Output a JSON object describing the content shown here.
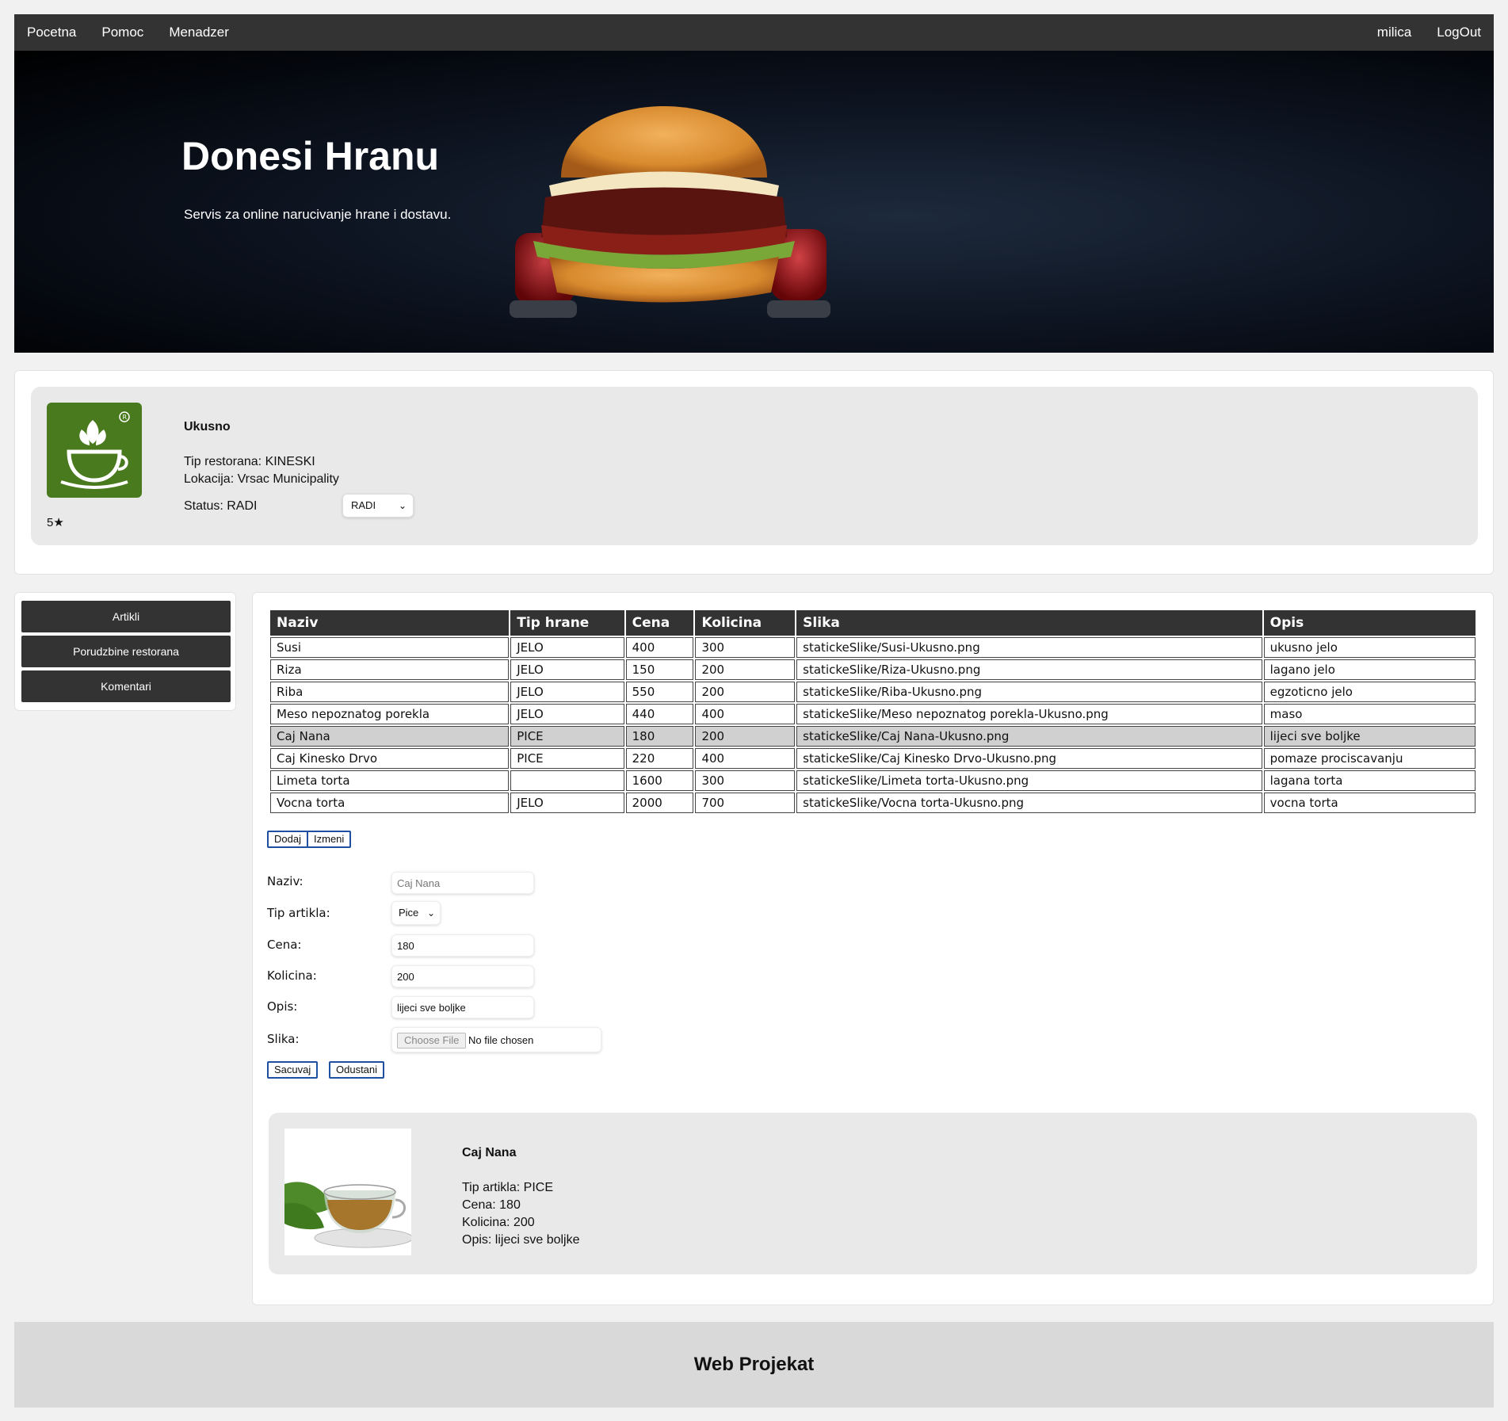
{
  "nav": {
    "left": [
      "Pocetna",
      "Pomoc",
      "Menadzer"
    ],
    "user": "milica",
    "logout": "LogOut"
  },
  "hero": {
    "title": "Donesi Hranu",
    "subtitle": "Servis za online narucivanje hrane i dostavu."
  },
  "restaurant": {
    "name": "Ukusno",
    "type": "Tip restorana: KINESKI",
    "location": "Lokacija: Vrsac Municipality",
    "status": "Status: RADI",
    "status_select": "RADI",
    "rating": "5★",
    "logo_color": "#4a7a1e",
    "logo_icon": "tea-cup-logo-icon"
  },
  "sidebar": {
    "items": [
      "Artikli",
      "Porudzbine restorana",
      "Komentari"
    ]
  },
  "table": {
    "headers": [
      "Naziv",
      "Tip hrane",
      "Cena",
      "Kolicina",
      "Slika",
      "Opis"
    ],
    "rows": [
      [
        "Susi",
        "JELO",
        "400",
        "300",
        "statickeSlike/Susi-Ukusno.png",
        "ukusno jelo"
      ],
      [
        "Riza",
        "JELO",
        "150",
        "200",
        "statickeSlike/Riza-Ukusno.png",
        "lagano jelo"
      ],
      [
        "Riba",
        "JELO",
        "550",
        "200",
        "statickeSlike/Riba-Ukusno.png",
        "egzoticno jelo"
      ],
      [
        "Meso nepoznatog porekla",
        "JELO",
        "440",
        "400",
        "statickeSlike/Meso nepoznatog porekla-Ukusno.png",
        "maso"
      ],
      [
        "Caj Nana",
        "PICE",
        "180",
        "200",
        "statickeSlike/Caj Nana-Ukusno.png",
        "lijeci sve boljke"
      ],
      [
        "Caj Kinesko Drvo",
        "PICE",
        "220",
        "400",
        "statickeSlike/Caj Kinesko Drvo-Ukusno.png",
        "pomaze prociscavanju"
      ],
      [
        "Limeta torta",
        "",
        "1600",
        "300",
        "statickeSlike/Limeta torta-Ukusno.png",
        "lagana torta"
      ],
      [
        "Vocna torta",
        "JELO",
        "2000",
        "700",
        "statickeSlike/Vocna torta-Ukusno.png",
        "vocna torta"
      ]
    ],
    "selected_row": 4
  },
  "actions": {
    "add": "Dodaj",
    "edit": "Izmeni"
  },
  "form": {
    "naziv_label": "Naziv:",
    "naziv_placeholder": "Caj Nana",
    "tip_label": "Tip artikla:",
    "tip_value": "Pice",
    "cena_label": "Cena:",
    "cena_value": "180",
    "kolicina_label": "Kolicina:",
    "kolicina_value": "200",
    "opis_label": "Opis:",
    "opis_value": "lijeci sve boljke",
    "slika_label": "Slika:",
    "file_button": "Choose File",
    "file_status": "No file chosen",
    "save": "Sacuvaj",
    "cancel": "Odustani"
  },
  "preview": {
    "name": "Caj Nana",
    "type": "Tip artikla: PICE",
    "price": "Cena: 180",
    "quantity": "Kolicina: 200",
    "description": "Opis: lijeci sve boljke"
  },
  "footer": {
    "title": "Web Projekat"
  },
  "colors": {
    "nav_bg": "#333333",
    "button_border": "#1f4fa0",
    "panel_bg": "#e9e9e9",
    "footer_bg": "#d9d9d9"
  }
}
